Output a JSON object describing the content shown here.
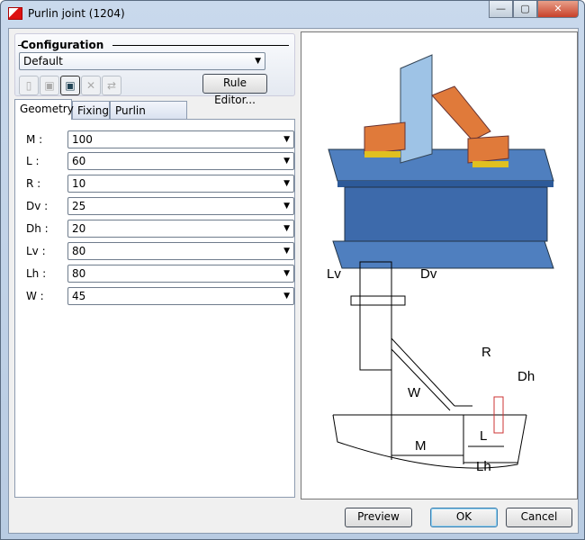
{
  "window": {
    "title": "Purlin joint (1204)",
    "minimize": "—",
    "maximize": "▢",
    "close": "✕"
  },
  "configuration": {
    "label": "Configuration",
    "selected": "Default",
    "rule_editor": "Rule Editor..."
  },
  "tabs": [
    {
      "label": "Geometry"
    },
    {
      "label": "Fixing"
    },
    {
      "label": "Purlin anchor"
    }
  ],
  "params": [
    {
      "label": "M :",
      "value": "100"
    },
    {
      "label": "L :",
      "value": "60"
    },
    {
      "label": "R :",
      "value": "10"
    },
    {
      "label": "Dv :",
      "value": "25"
    },
    {
      "label": "Dh :",
      "value": "20"
    },
    {
      "label": "Lv :",
      "value": "80"
    },
    {
      "label": "Lh :",
      "value": "80"
    },
    {
      "label": "W :",
      "value": "45"
    }
  ],
  "diagram": {
    "labels": {
      "Lv": "Lv",
      "Dv": "Dv",
      "R": "R",
      "Dh": "Dh",
      "W": "W",
      "M": "M",
      "L": "L",
      "Lh": "Lh"
    }
  },
  "buttons": {
    "preview": "Preview",
    "ok": "OK",
    "cancel": "Cancel"
  }
}
